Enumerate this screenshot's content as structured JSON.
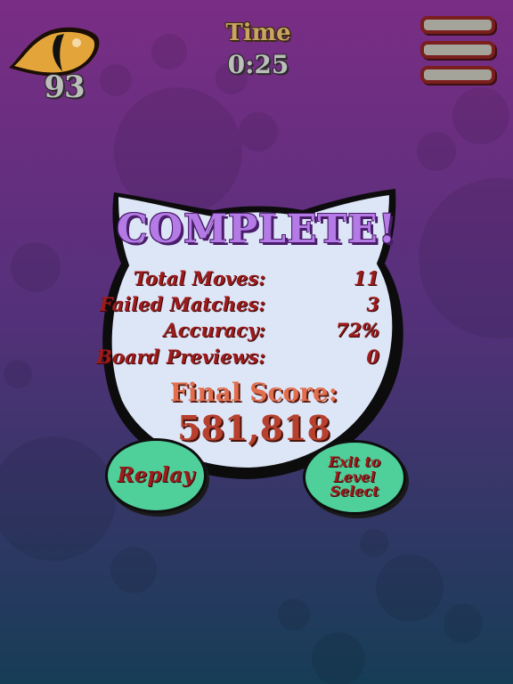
{
  "theme": {
    "bg_top": "#7a2d85",
    "bg_bottom": "#163d56",
    "panel_fill": "#dde6f7",
    "title_color": "#b47be6",
    "stat_text_color": "#9e1b1b",
    "score_label_color": "#e26e4d",
    "score_value_color": "#b8402e",
    "button_fill": "#4fcf9a",
    "menu_bar_fill": "#a5a49a",
    "menu_bar_border": "#7a1e1e",
    "eye_color": "#e3a53a"
  },
  "hud": {
    "eye_icon": "cat-eye-icon",
    "eye_count": "93",
    "time_label": "Time",
    "time_value": "0:25",
    "menu_icon": "hamburger-menu-icon"
  },
  "results": {
    "title": "COMPLETE!",
    "stats": [
      {
        "label": "Total Moves:",
        "value": "11"
      },
      {
        "label": "Failed Matches:",
        "value": "3"
      },
      {
        "label": "Accuracy:",
        "value": "72%"
      },
      {
        "label": "Board Previews:",
        "value": "0"
      }
    ],
    "final_score_label": "Final Score:",
    "final_score_value": "581,818"
  },
  "buttons": {
    "replay_label": "Replay",
    "exit_label": "Exit to Level Select"
  }
}
